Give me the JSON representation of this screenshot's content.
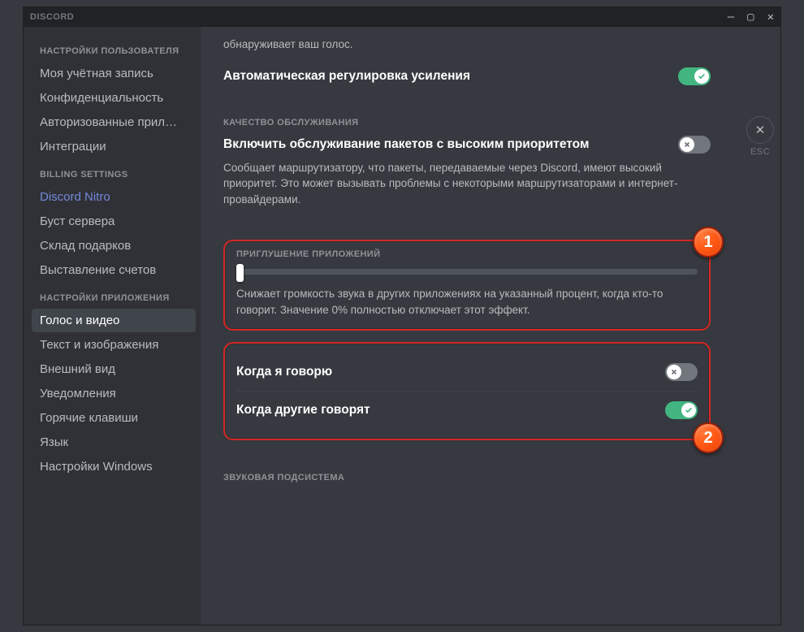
{
  "titlebar": {
    "brand": "DISCORD"
  },
  "esc": {
    "label": "ESC",
    "icon": "✕"
  },
  "sidebar": {
    "sections": [
      {
        "header": "НАСТРОЙКИ ПОЛЬЗОВАТЕЛЯ",
        "items": [
          {
            "label": "Моя учётная запись"
          },
          {
            "label": "Конфиденциальность"
          },
          {
            "label": "Авторизованные прил…"
          },
          {
            "label": "Интеграции"
          }
        ]
      },
      {
        "header": "BILLING SETTINGS",
        "items": [
          {
            "label": "Discord Nitro",
            "nitro": true
          },
          {
            "label": "Буст сервера"
          },
          {
            "label": "Склад подарков"
          },
          {
            "label": "Выставление счетов"
          }
        ]
      },
      {
        "header": "НАСТРОЙКИ ПРИЛОЖЕНИЯ",
        "items": [
          {
            "label": "Голос и видео",
            "active": true
          },
          {
            "label": "Текст и изображения"
          },
          {
            "label": "Внешний вид"
          },
          {
            "label": "Уведомления"
          },
          {
            "label": "Горячие клавиши"
          },
          {
            "label": "Язык"
          },
          {
            "label": "Настройки Windows"
          }
        ]
      }
    ]
  },
  "content": {
    "truncated": "обнаруживает ваш голос.",
    "auto_gain": {
      "title": "Автоматическая регулировка усиления",
      "on": true
    },
    "qos": {
      "header": "КАЧЕСТВО ОБСЛУЖИВАНИЯ",
      "title": "Включить обслуживание пакетов с высоким приоритетом",
      "on": false,
      "desc": "Сообщает маршрутизатору, что пакеты, передаваемые через Discord, имеют высокий приоритет. Это может вызывать проблемы с некоторыми маршрутизаторами и интернет-провайдерами."
    },
    "attenuation": {
      "header": "ПРИГЛУШЕНИЕ ПРИЛОЖЕНИЙ",
      "desc": "Снижает громкость звука в других приложениях на указанный процент, когда кто-то говорит. Значение 0% полностью отключает этот эффект.",
      "value": 0
    },
    "when_i_speak": {
      "title": "Когда я говорю",
      "on": false
    },
    "when_others_speak": {
      "title": "Когда другие говорят",
      "on": true
    },
    "audio_subsystem": {
      "header": "ЗВУКОВАЯ ПОДСИСТЕМА"
    },
    "badges": {
      "one": "1",
      "two": "2"
    }
  }
}
